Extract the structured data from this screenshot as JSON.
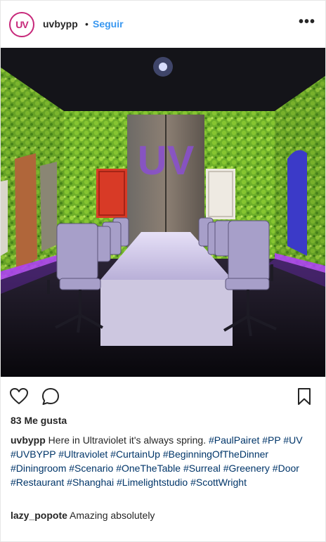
{
  "header": {
    "avatar_text": "UV",
    "username": "uvbypp",
    "separator": "•",
    "follow_label": "Seguir",
    "more_label": "•••"
  },
  "photo": {
    "wall_text": "UV"
  },
  "actions": {
    "like_icon": "heart-icon",
    "comment_icon": "comment-bubble-icon",
    "save_icon": "bookmark-icon"
  },
  "likes_text": "83 Me gusta",
  "caption": {
    "username": "uvbypp",
    "text": "Here in Ultraviolet it's always spring.",
    "hashtags": [
      "#PaulPairet",
      "#PP",
      "#UV",
      "#UVBYPP",
      "#Ultraviolet",
      "#CurtainUp",
      "#BeginningOfTheDinner",
      "#Diningroom",
      "#Scenario",
      "#OneTheTable",
      "#Surreal",
      "#Greenery",
      "#Door",
      "#Restaurant",
      "#Shanghai",
      "#Limelightstudio",
      "#ScottWright"
    ]
  },
  "comment": {
    "username": "lazy_popote",
    "text": "Amazing absolutely"
  },
  "colors": {
    "accent": "#3897f0",
    "hashtag": "#003569",
    "brand": "#c7287a"
  }
}
